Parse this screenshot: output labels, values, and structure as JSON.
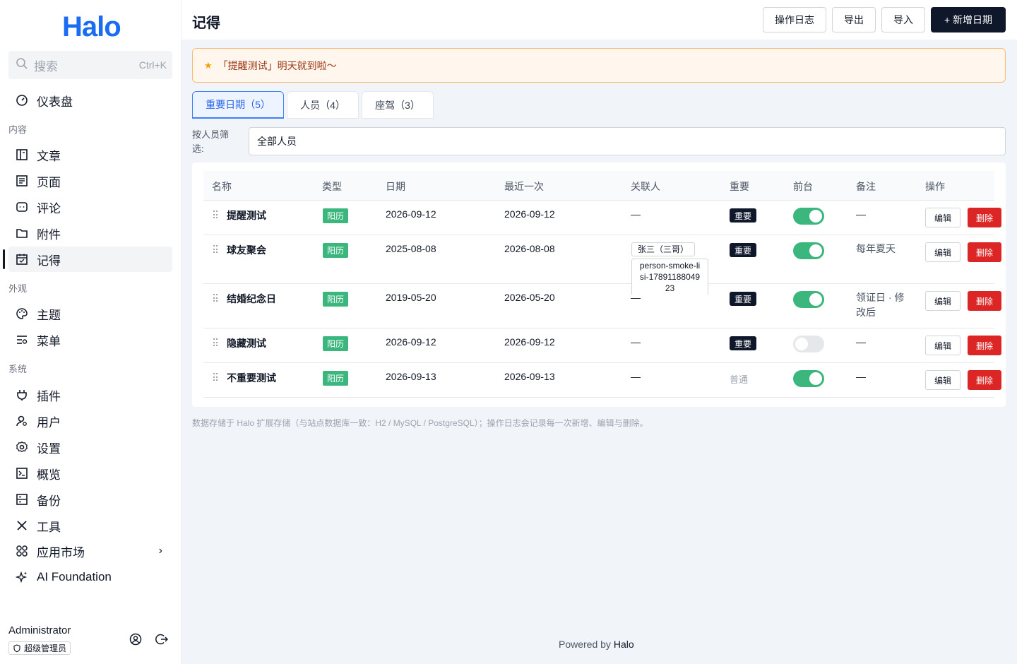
{
  "sidebar": {
    "logo": "Halo",
    "search": {
      "placeholder": "搜索",
      "shortcut": "Ctrl+K"
    },
    "dashboard": "仪表盘",
    "sections": {
      "content": "内容",
      "appearance": "外观",
      "system": "系统"
    },
    "content_items": [
      "文章",
      "页面",
      "评论",
      "附件",
      "记得"
    ],
    "appearance_items": [
      "主题",
      "菜单"
    ],
    "system_items": [
      "插件",
      "用户",
      "设置",
      "概览",
      "备份",
      "工具",
      "应用市场",
      "AI Foundation"
    ],
    "active_item": "记得",
    "user": {
      "name": "Administrator",
      "role": "超级管理员"
    }
  },
  "header": {
    "title": "记得",
    "buttons": {
      "log": "操作日志",
      "export": "导出",
      "import": "导入",
      "add": "+ 新增日期"
    }
  },
  "alert": {
    "text": "「提醒测试」明天就到啦～"
  },
  "tabs": [
    {
      "label": "重要日期（5）",
      "active": true
    },
    {
      "label": "人员（4）",
      "active": false
    },
    {
      "label": "座驾（3）",
      "active": false
    }
  ],
  "filter": {
    "label": "按人员筛选:",
    "value": "全部人员"
  },
  "table": {
    "headers": [
      "名称",
      "类型",
      "日期",
      "最近一次",
      "关联人",
      "重要",
      "前台",
      "备注",
      "操作"
    ],
    "rows": [
      {
        "name": "提醒测试",
        "type": "阳历",
        "date": "2026-09-12",
        "next": "2026-09-12",
        "people": [
          "—"
        ],
        "important": "重要",
        "is_important": true,
        "frontend": true,
        "note": "—",
        "edit": "编辑",
        "delete": "删除"
      },
      {
        "name": "球友聚会",
        "type": "阳历",
        "date": "2025-08-08",
        "next": "2026-08-08",
        "people": [
          "张三（三哥）",
          "person-smoke-lisi-1789118804923"
        ],
        "important": "重要",
        "is_important": true,
        "frontend": true,
        "note": "每年夏天",
        "edit": "编辑",
        "delete": "删除"
      },
      {
        "name": "结婚纪念日",
        "type": "阳历",
        "date": "2019-05-20",
        "next": "2026-05-20",
        "people": [
          "—"
        ],
        "important": "重要",
        "is_important": true,
        "frontend": true,
        "note": "领证日 · 修改后",
        "edit": "编辑",
        "delete": "删除"
      },
      {
        "name": "隐藏测试",
        "type": "阳历",
        "date": "2026-09-12",
        "next": "2026-09-12",
        "people": [
          "—"
        ],
        "important": "重要",
        "is_important": true,
        "frontend": false,
        "note": "—",
        "edit": "编辑",
        "delete": "删除"
      },
      {
        "name": "不重要测试",
        "type": "阳历",
        "date": "2026-09-13",
        "next": "2026-09-13",
        "people": [
          "—"
        ],
        "important": "普通",
        "is_important": false,
        "frontend": true,
        "note": "—",
        "edit": "编辑",
        "delete": "删除"
      }
    ]
  },
  "footnote": "数据存储于 Halo 扩展存储（与站点数据库一致：H2 / MySQL / PostgreSQL）；操作日志会记录每一次新增、编辑与删除。",
  "powered": {
    "prefix": "Powered by",
    "brand": "Halo"
  },
  "colors": {
    "accent": "#1a6df0",
    "primary_dark": "#0f172a",
    "green": "#3bb77e",
    "danger": "#dc2626",
    "alert_bg": "#fff7ed"
  }
}
